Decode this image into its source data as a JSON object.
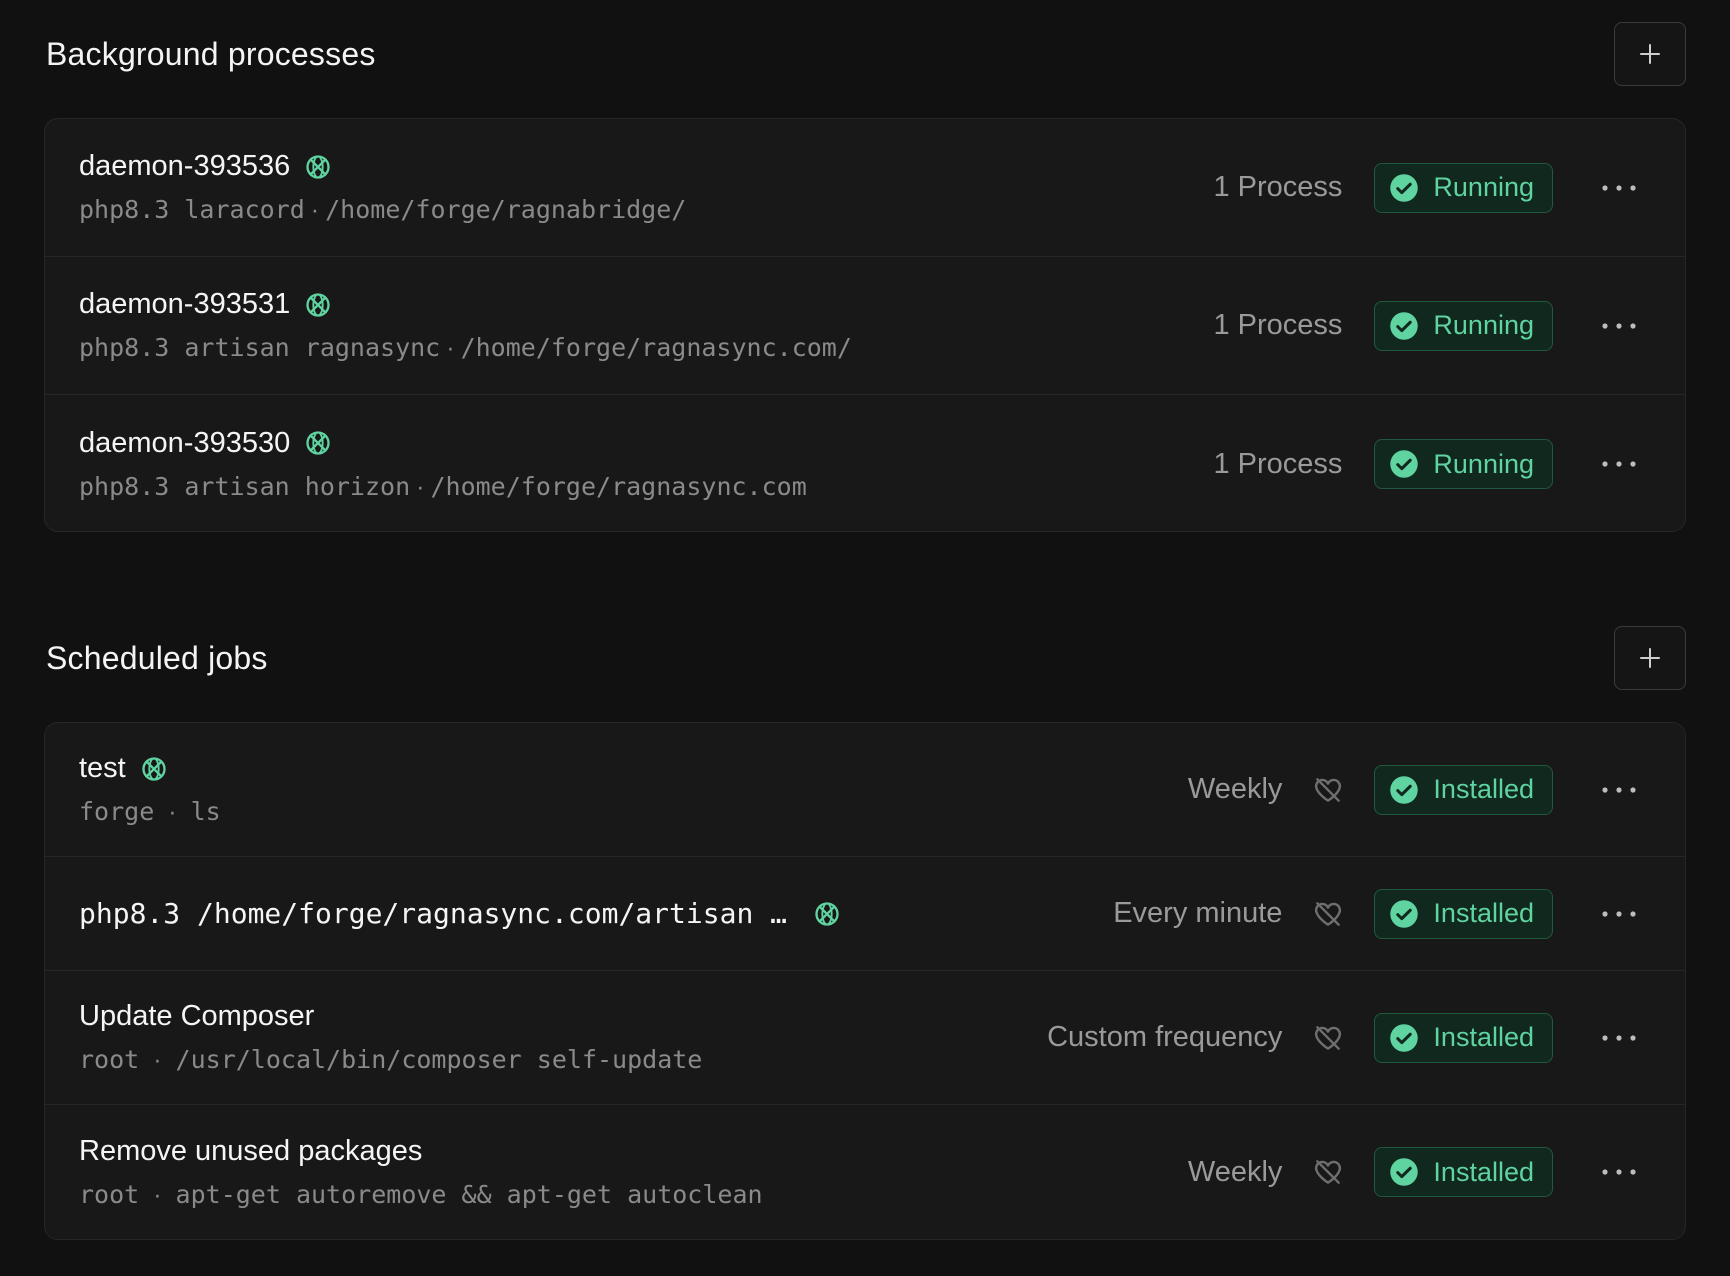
{
  "background_processes": {
    "title": "Background processes",
    "add_label": "+",
    "items": [
      {
        "name": "daemon-393536",
        "command": "php8.3 laracord",
        "path": "/home/forge/ragnabridge/",
        "count": "1 Process",
        "status": "Running"
      },
      {
        "name": "daemon-393531",
        "command": "php8.3 artisan ragnasync",
        "path": "/home/forge/ragnasync.com/",
        "count": "1 Process",
        "status": "Running"
      },
      {
        "name": "daemon-393530",
        "command": "php8.3 artisan horizon",
        "path": "/home/forge/ragnasync.com",
        "count": "1 Process",
        "status": "Running"
      }
    ]
  },
  "scheduled_jobs": {
    "title": "Scheduled jobs",
    "add_label": "+",
    "items": [
      {
        "name": "test",
        "user": "forge",
        "command": "ls",
        "frequency": "Weekly",
        "status": "Installed"
      },
      {
        "name": "php8.3 /home/forge/ragnasync.com/artisan …",
        "frequency": "Every minute",
        "status": "Installed"
      },
      {
        "name": "Update Composer",
        "user": "root",
        "command": "/usr/local/bin/composer self-update",
        "frequency": "Custom frequency",
        "status": "Installed"
      },
      {
        "name": "Remove unused packages",
        "user": "root",
        "command": "apt-get autoremove && apt-get autoclean",
        "frequency": "Weekly",
        "status": "Installed"
      }
    ]
  },
  "separators": {
    "dot": "·"
  },
  "colors": {
    "accent": "#5fd3a0",
    "badge_bg": "#10281d",
    "badge_border": "#1f5a40",
    "background": "#111111",
    "card": "#181818"
  },
  "icons": {
    "globe_off": "globe-off-icon",
    "check_circle": "check-circle-icon",
    "heart_off": "heart-off-icon",
    "plus": "plus-icon",
    "more": "more-icon"
  }
}
